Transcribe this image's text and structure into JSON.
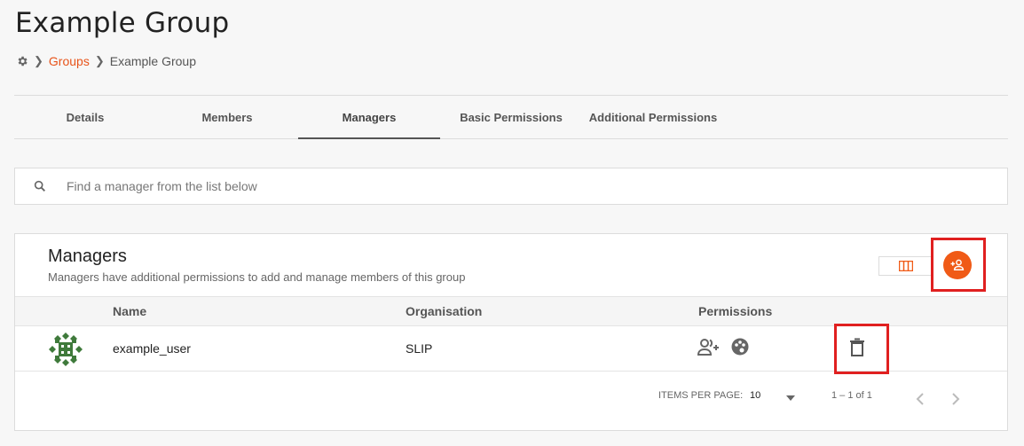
{
  "page": {
    "title": "Example Group"
  },
  "breadcrumb": {
    "home_icon": "gear-icon",
    "items": [
      "Groups",
      "Example Group"
    ]
  },
  "tabs": [
    {
      "label": "Details"
    },
    {
      "label": "Members"
    },
    {
      "label": "Managers",
      "active": true
    },
    {
      "label": "Basic Permissions"
    },
    {
      "label": "Additional Permissions"
    }
  ],
  "search": {
    "placeholder": "Find a manager from the list below",
    "value": ""
  },
  "managers": {
    "title": "Managers",
    "subtitle": "Managers have additional permissions to add and manage members of this group",
    "view_toggle_icon": "column-view-icon",
    "add_icon": "add-person-icon",
    "columns": {
      "name": "Name",
      "organisation": "Organisation",
      "permissions": "Permissions"
    },
    "rows": [
      {
        "name": "example_user",
        "organisation": "SLIP",
        "permission_icons": [
          "manage-members-icon",
          "palette-icon"
        ],
        "action_icon": "delete-icon"
      }
    ]
  },
  "paginator": {
    "items_per_page_label": "ITEMS PER PAGE:",
    "page_size": "10",
    "range": "1 – 1 of 1"
  },
  "colors": {
    "accent": "#f05a16",
    "link": "#e8541a",
    "highlight": "#e02020",
    "avatar": "#3f7a3b"
  }
}
